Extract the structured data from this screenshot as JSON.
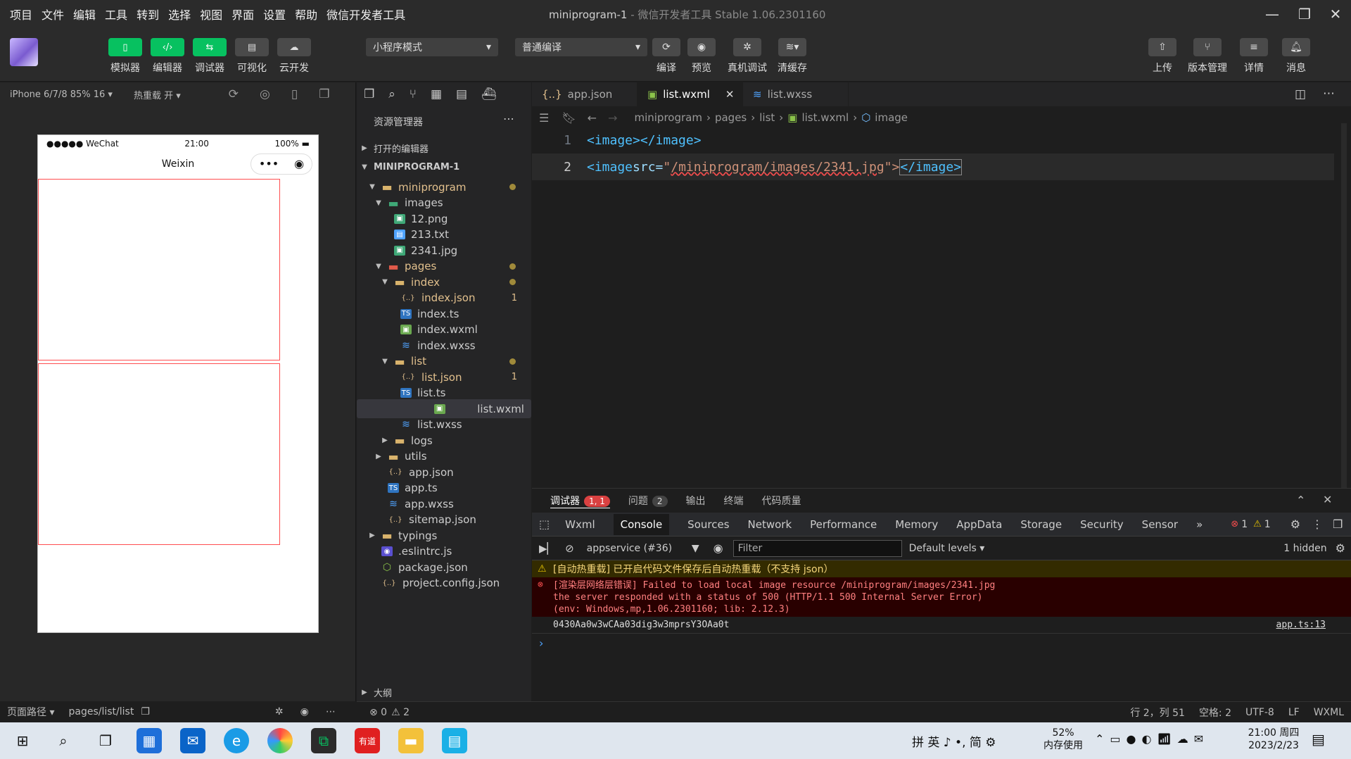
{
  "window": {
    "menu": [
      "项目",
      "文件",
      "编辑",
      "工具",
      "转到",
      "选择",
      "视图",
      "界面",
      "设置",
      "帮助",
      "微信开发者工具"
    ],
    "title": "miniprogram-1",
    "subtitle": "- 微信开发者工具 Stable 1.06.2301160",
    "controls": [
      "minimize",
      "restore",
      "close"
    ]
  },
  "toolbar": {
    "left_buttons": [
      {
        "label": "模拟器",
        "icon": "phone-icon"
      },
      {
        "label": "编辑器",
        "icon": "code-icon"
      },
      {
        "label": "调试器",
        "icon": "sliders-icon"
      },
      {
        "label": "可视化",
        "icon": "layout-icon"
      },
      {
        "label": "云开发",
        "icon": "cloud-icon"
      }
    ],
    "mode_select": "小程序模式",
    "compile_select": "普通编译",
    "mid_buttons": [
      {
        "label": "编译",
        "icon": "refresh-icon"
      },
      {
        "label": "预览",
        "icon": "eye-icon"
      },
      {
        "label": "真机调试",
        "icon": "bug-icon"
      },
      {
        "label": "清缓存",
        "icon": "layers-icon"
      }
    ],
    "right_buttons": [
      {
        "label": "上传",
        "icon": "upload-icon"
      },
      {
        "label": "版本管理",
        "icon": "branch-icon"
      },
      {
        "label": "详情",
        "icon": "menu-icon"
      },
      {
        "label": "消息",
        "icon": "bell-icon"
      }
    ]
  },
  "simulator": {
    "device": "iPhone 6/7/8 85% 16 ▾",
    "hot_reload": "热重载 开 ▾",
    "status_carrier": "●●●●● WeChat",
    "status_time": "21:00",
    "status_battery": "100%",
    "nav_title": "Weixin",
    "capsule_more": "•••",
    "footer_path_label": "页面路径 ▾",
    "footer_path": "pages/list/list"
  },
  "explorer": {
    "header": "资源管理器",
    "sections": [
      "打开的编辑器",
      "MINIPROGRAM-1"
    ],
    "outline": "大纲",
    "tree": [
      {
        "name": "miniprogram",
        "depth": 1,
        "type": "folder",
        "open": true,
        "dot": true
      },
      {
        "name": "images",
        "depth": 2,
        "type": "folder-img",
        "open": true
      },
      {
        "name": "12.png",
        "depth": 3,
        "type": "img"
      },
      {
        "name": "213.txt",
        "depth": 3,
        "type": "txt"
      },
      {
        "name": "2341.jpg",
        "depth": 3,
        "type": "img"
      },
      {
        "name": "pages",
        "depth": 2,
        "type": "folder-red",
        "open": true,
        "dot": true
      },
      {
        "name": "index",
        "depth": 3,
        "type": "folder",
        "open": true,
        "dot": true
      },
      {
        "name": "index.json",
        "depth": 4,
        "type": "json",
        "count": "1"
      },
      {
        "name": "index.ts",
        "depth": 4,
        "type": "ts"
      },
      {
        "name": "index.wxml",
        "depth": 4,
        "type": "wxml"
      },
      {
        "name": "index.wxss",
        "depth": 4,
        "type": "wxss"
      },
      {
        "name": "list",
        "depth": 3,
        "type": "folder",
        "open": true,
        "dot": true
      },
      {
        "name": "list.json",
        "depth": 4,
        "type": "json",
        "count": "1"
      },
      {
        "name": "list.ts",
        "depth": 4,
        "type": "ts"
      },
      {
        "name": "list.wxml",
        "depth": 4,
        "type": "wxml",
        "selected": true
      },
      {
        "name": "list.wxss",
        "depth": 4,
        "type": "wxss"
      },
      {
        "name": "logs",
        "depth": 3,
        "type": "folder",
        "open": false
      },
      {
        "name": "utils",
        "depth": 2,
        "type": "folder",
        "open": false
      },
      {
        "name": "app.json",
        "depth": 2,
        "type": "json"
      },
      {
        "name": "app.ts",
        "depth": 2,
        "type": "ts"
      },
      {
        "name": "app.wxss",
        "depth": 2,
        "type": "wxss"
      },
      {
        "name": "sitemap.json",
        "depth": 2,
        "type": "json"
      },
      {
        "name": "typings",
        "depth": 1,
        "type": "folder",
        "open": false
      },
      {
        "name": ".eslintrc.js",
        "depth": 1,
        "type": "eslint"
      },
      {
        "name": "package.json",
        "depth": 1,
        "type": "pkg"
      },
      {
        "name": "project.config.json",
        "depth": 1,
        "type": "json"
      }
    ]
  },
  "editor": {
    "tabs": [
      {
        "label": "app.json",
        "icon": "json-icon"
      },
      {
        "label": "list.wxml",
        "icon": "wxml-icon",
        "active": true
      },
      {
        "label": "list.wxss",
        "icon": "wxss-icon"
      }
    ],
    "breadcrumb": [
      "miniprogram",
      "pages",
      "list",
      "list.wxml",
      "image"
    ],
    "line1": {
      "num": "1",
      "open": "<image>",
      "close": "</image>"
    },
    "line2": {
      "num": "2",
      "open": "<image ",
      "attr": "src=",
      "quote": "\"",
      "value": "/miniprogram/images/2341.jpg",
      "end": "\">",
      "close": "</image>"
    }
  },
  "devtools": {
    "top_tabs": [
      "调试器",
      "问题",
      "输出",
      "终端",
      "代码质量"
    ],
    "debugger_badge": "1, 1",
    "problems_badge": "2",
    "tabs": [
      "Wxml",
      "Console",
      "Sources",
      "Network",
      "Performance",
      "Memory",
      "AppData",
      "Storage",
      "Security",
      "Sensor"
    ],
    "active_tab": "Console",
    "more_tabs": "»",
    "errors": "1",
    "warnings": "1",
    "context": "appservice (#36)",
    "filter_placeholder": "Filter",
    "levels": "Default levels ▾",
    "hidden": "1 hidden",
    "messages": [
      {
        "level": "warn",
        "text": "[自动热重载] 已开启代码文件保存后自动热重载（不支持 json）"
      },
      {
        "level": "error",
        "text": "[渲染层网络层错误] Failed to load local image resource /miniprogram/images/2341.jpg",
        "text2": " the server responded with a status of 500 (HTTP/1.1 500 Internal Server Error)",
        "text3": "(env: Windows,mp,1.06.2301160; lib: 2.12.3)"
      },
      {
        "level": "log",
        "text": "0430Aa0w3wCAa03dig3w3mprsY3OAa0t",
        "source": "app.ts:13"
      }
    ],
    "prompt": "›"
  },
  "statusbar": {
    "errors": "⊗ 0",
    "warnings": "⚠ 2",
    "position": "行 2，列 51",
    "spaces": "空格: 2",
    "encoding": "UTF-8",
    "eol": "LF",
    "language": "WXML"
  },
  "taskbar": {
    "ime": "拼 英 ♪ •, 简 ⚙",
    "memory_pct": "52%",
    "memory_label": "内存使用",
    "time": "21:00 周四",
    "date": "2023/2/23"
  }
}
